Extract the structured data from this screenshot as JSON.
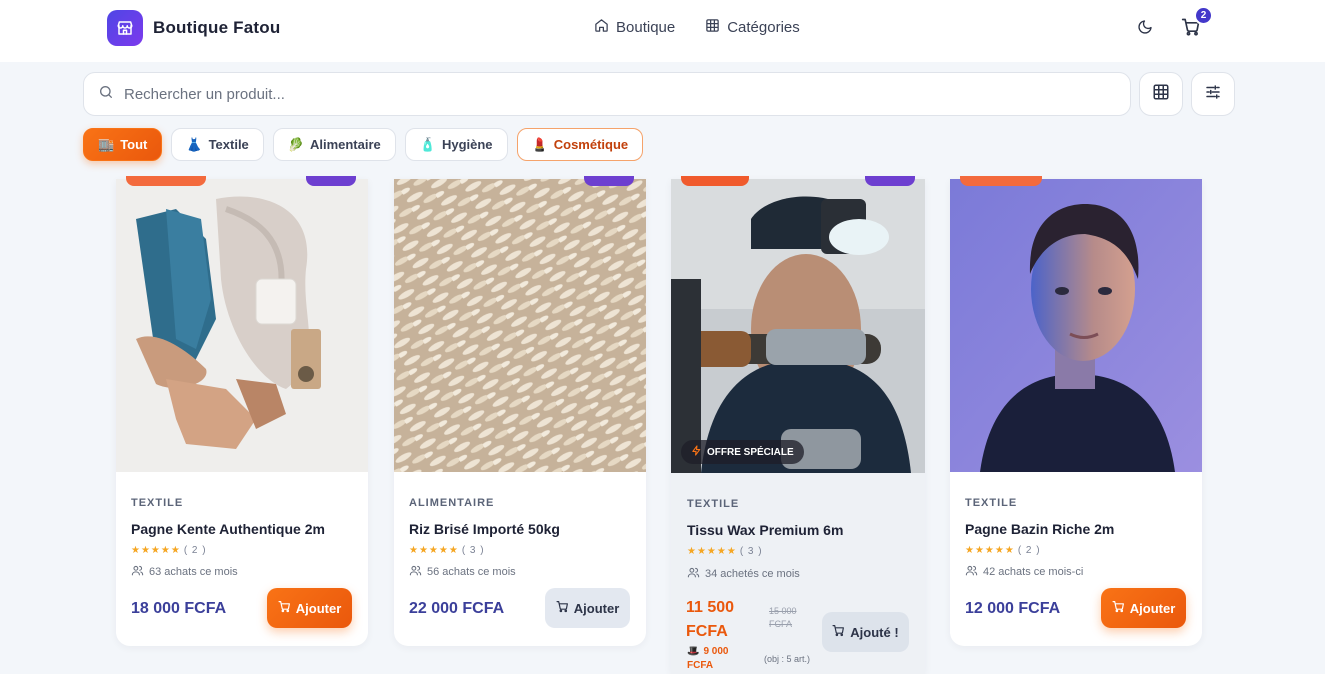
{
  "header": {
    "brand": "Boutique Fatou",
    "nav": [
      {
        "label": "Boutique",
        "icon": "home-icon"
      },
      {
        "label": "Catégories",
        "icon": "grid-icon"
      }
    ],
    "cart_count": "2"
  },
  "search": {
    "placeholder": "Rechercher un produit..."
  },
  "categories": [
    {
      "emoji": "🏬",
      "label": "Tout"
    },
    {
      "emoji": "👗",
      "label": "Textile"
    },
    {
      "emoji": "🥬",
      "label": "Alimentaire"
    },
    {
      "emoji": "🧴",
      "label": "Hygiène"
    },
    {
      "emoji": "💄",
      "label": "Cosmétique"
    }
  ],
  "products": [
    {
      "category": "TEXTILE",
      "title": "Pagne Kente Authentique 2m",
      "stars": "★★★★★",
      "reviews": "( 2 )",
      "sold": "63 achats ce mois",
      "price": "18 000 FCFA",
      "button": "Ajouter"
    },
    {
      "category": "ALIMENTAIRE",
      "title": "Riz Brisé Importé 50kg",
      "stars": "★★★★★",
      "reviews": "( 3 )",
      "sold": "56 achats ce mois",
      "price": "22 000 FCFA",
      "button": "Ajouter"
    },
    {
      "category": "TEXTILE",
      "title": "Tissu Wax Premium 6m",
      "stars": "★★★★★",
      "reviews": "( 3 )",
      "sold": "34 achetés ce mois",
      "price_line1": "11 500",
      "price_line2": "FCFA",
      "old_price_line1": "15 000",
      "old_price_line2": "FCFA",
      "group_price_line1": "9 000",
      "group_price_line2": "FCFA",
      "group_objective": "(obj : 5 art.)",
      "badge": "OFFRE SPÉCIALE",
      "button": "Ajouté !"
    },
    {
      "category": "TEXTILE",
      "title": "Pagne Bazin Riche 2m",
      "stars": "★★★★★",
      "reviews": "( 2 )",
      "sold": "42 achats ce mois-ci",
      "price": "12 000 FCFA",
      "button": "Ajouter"
    }
  ],
  "colors": {
    "accent_orange": "#f97316",
    "brand_indigo": "#4338ca",
    "price_indigo": "#3b3f9a",
    "offer_red": "#ea580c",
    "star_gold": "#f5a623"
  }
}
